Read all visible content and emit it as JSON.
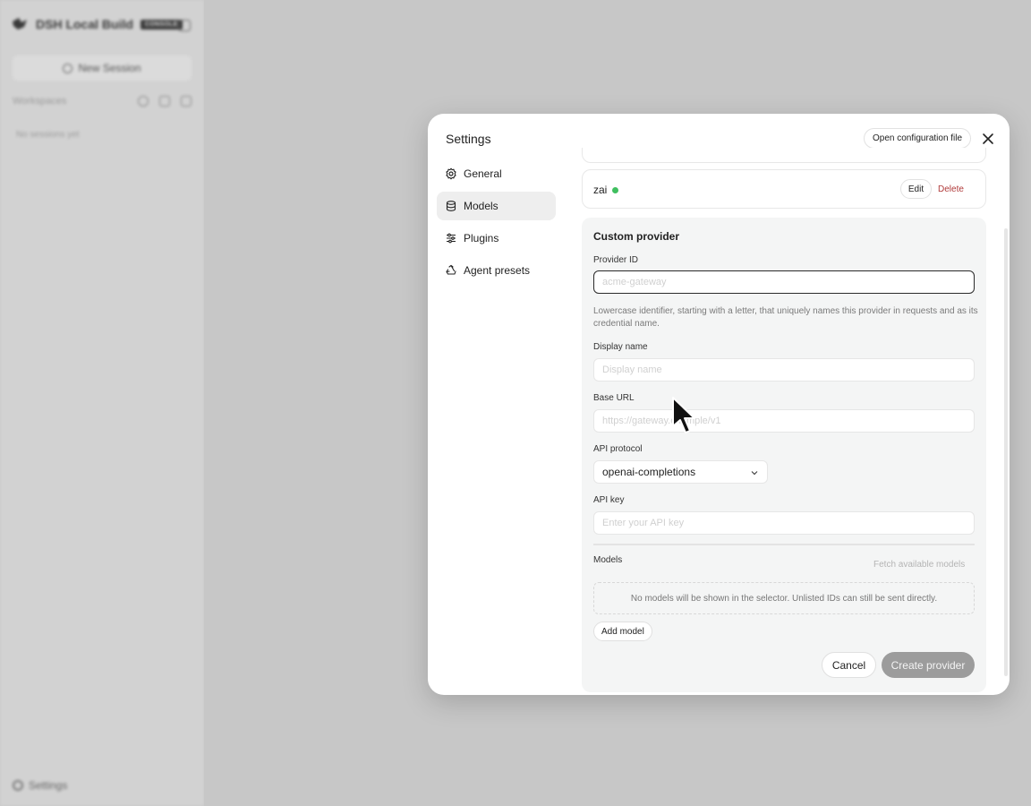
{
  "app": {
    "title": "DSH Local Build",
    "badge": "CONSOLE",
    "new_session_label": "New Session",
    "workspaces_label": "Workspaces",
    "no_sessions_label": "No sessions yet",
    "settings_label": "Settings"
  },
  "modal": {
    "title": "Settings",
    "open_config_label": "Open configuration file",
    "nav": [
      {
        "label": "General",
        "icon": "gear-icon"
      },
      {
        "label": "Models",
        "icon": "database-icon",
        "active": true
      },
      {
        "label": "Plugins",
        "icon": "sliders-icon"
      },
      {
        "label": "Agent presets",
        "icon": "recycle-icon"
      }
    ],
    "provider": {
      "name": "zai",
      "status_color": "#3fbf5f",
      "edit_label": "Edit",
      "delete_label": "Delete"
    },
    "custom_provider": {
      "title": "Custom provider",
      "provider_id_label": "Provider ID",
      "provider_id_placeholder": "acme-gateway",
      "provider_id_help": "Lowercase identifier, starting with a letter, that uniquely names this provider in requests and as its credential name.",
      "display_name_label": "Display name",
      "display_name_placeholder": "Display name",
      "base_url_label": "Base URL",
      "base_url_placeholder": "https://gateway.example/v1",
      "api_protocol_label": "API protocol",
      "api_protocol_value": "openai-completions",
      "api_key_label": "API key",
      "api_key_placeholder": "Enter your API key",
      "models_label": "Models",
      "fetch_models_label": "Fetch available models",
      "models_empty_text": "No models will be shown in the selector. Unlisted IDs can still be sent directly.",
      "add_model_label": "Add model",
      "cancel_label": "Cancel",
      "create_label": "Create provider"
    }
  }
}
